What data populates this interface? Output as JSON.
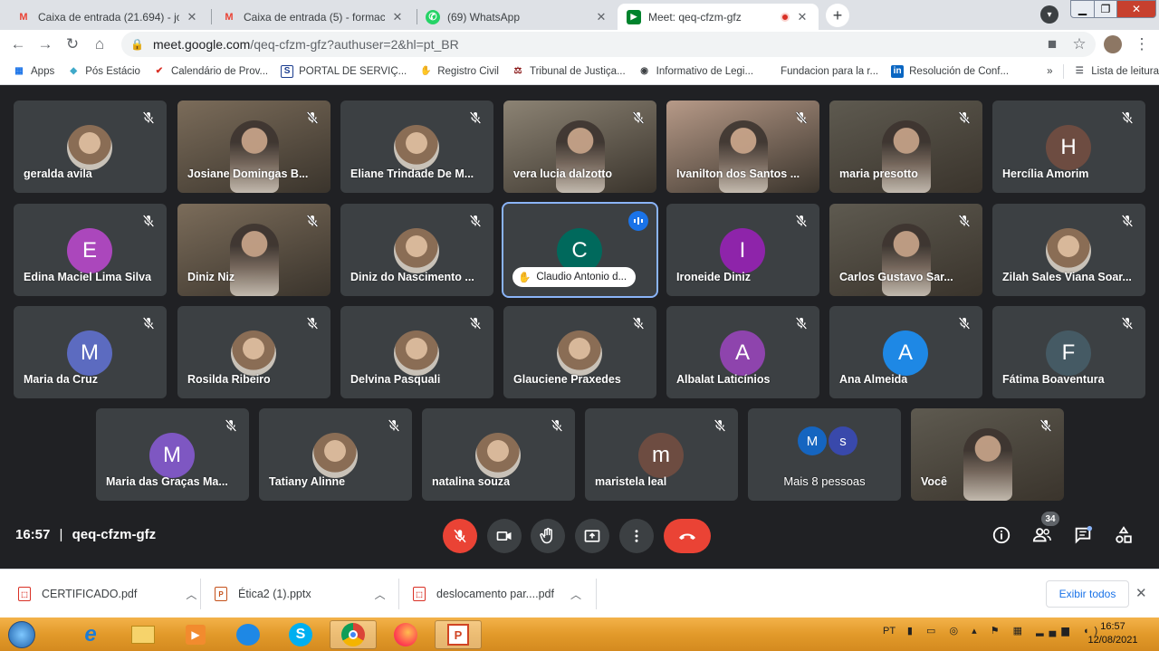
{
  "browser": {
    "tabs": [
      {
        "title": "Caixa de entrada (21.694) - josele",
        "icon": "gmail-icon",
        "active": false
      },
      {
        "title": "Caixa de entrada (5) - formacao@",
        "icon": "gmail-icon",
        "active": false
      },
      {
        "title": "(69) WhatsApp",
        "icon": "whatsapp-icon",
        "active": false
      },
      {
        "title": "Meet: qeq-cfzm-gfz",
        "icon": "meet-icon",
        "active": true
      }
    ],
    "url_host": "meet.google.com",
    "url_path": "/qeq-cfzm-gfz?authuser=2&hl=pt_BR",
    "bookmarks": [
      {
        "label": "Apps",
        "icon": "apps-grid-icon"
      },
      {
        "label": "Pós Estácio",
        "icon": "diamond-icon"
      },
      {
        "label": "Calendário de Prov...",
        "icon": "check-icon"
      },
      {
        "label": "PORTAL DE SERVIÇ...",
        "icon": "s-logo-icon"
      },
      {
        "label": "Registro Civil",
        "icon": "hand-icon"
      },
      {
        "label": "Tribunal de Justiça...",
        "icon": "court-icon"
      },
      {
        "label": "Informativo de Legi...",
        "icon": "globe-icon"
      },
      {
        "label": "Fundacion para la r...",
        "icon": ""
      },
      {
        "label": "Resolución de Conf...",
        "icon": "linkedin-icon"
      }
    ],
    "bookmarks_more": "»",
    "reading_list": "Lista de leitura"
  },
  "meet": {
    "rows": [
      [
        {
          "name": "geralda avila",
          "type": "photo-avatar"
        },
        {
          "name": "Josiane Domingas B...",
          "type": "video"
        },
        {
          "name": "Eliane Trindade De M...",
          "type": "photo-avatar"
        },
        {
          "name": "vera lucia dalzotto",
          "type": "video"
        },
        {
          "name": "Ivanilton dos Santos ...",
          "type": "video"
        },
        {
          "name": "maria presotto",
          "type": "video"
        },
        {
          "name": "Hercília Amorim",
          "type": "letter",
          "letter": "H",
          "color": "#6d4c41"
        }
      ],
      [
        {
          "name": "Edina Maciel Lima Silva",
          "type": "letter",
          "letter": "E",
          "color": "#ab47bc"
        },
        {
          "name": "Diniz Niz",
          "type": "video"
        },
        {
          "name": "Diniz do Nascimento ...",
          "type": "photo-avatar"
        },
        {
          "name": "Claudio Antonio d...",
          "type": "letter",
          "letter": "C",
          "color": "#00695c",
          "speaking": true,
          "hand": true
        },
        {
          "name": "Ironeide Diniz",
          "type": "letter",
          "letter": "I",
          "color": "#8e24aa"
        },
        {
          "name": "Carlos Gustavo Sar...",
          "type": "video"
        },
        {
          "name": "Zilah Sales Viana Soar...",
          "type": "photo-avatar"
        }
      ],
      [
        {
          "name": "Maria da Cruz",
          "type": "letter",
          "letter": "M",
          "color": "#5c6bc0"
        },
        {
          "name": "Rosilda Ribeiro",
          "type": "photo-avatar"
        },
        {
          "name": "Delvina Pasquali",
          "type": "photo-avatar"
        },
        {
          "name": "Glauciene Praxedes",
          "type": "photo-avatar"
        },
        {
          "name": "Albalat Laticínios",
          "type": "letter",
          "letter": "A",
          "color": "#8e44ad"
        },
        {
          "name": "Ana Almeida",
          "type": "letter",
          "letter": "A",
          "color": "#1e88e5"
        },
        {
          "name": "Fátima Boaventura",
          "type": "letter",
          "letter": "F",
          "color": "#455a64"
        }
      ],
      [
        {
          "name": "Maria das Graças Ma...",
          "type": "letter",
          "letter": "M",
          "color": "#7e57c2"
        },
        {
          "name": "Tatiany Alinne",
          "type": "photo-avatar"
        },
        {
          "name": "natalina souza",
          "type": "photo-avatar"
        },
        {
          "name": "maristela leal",
          "type": "letter",
          "letter": "m",
          "color": "#6d4c41"
        },
        {
          "name": "Mais 8 pessoas",
          "type": "more",
          "letters": [
            "M",
            "s"
          ]
        },
        {
          "name": "Você",
          "type": "video"
        }
      ]
    ],
    "time": "16:57",
    "meeting_code": "qeq-cfzm-gfz",
    "participant_count": "34"
  },
  "downloads": {
    "items": [
      {
        "name": "CERTIFICADO.pdf",
        "icon": "pdf-file-icon"
      },
      {
        "name": "Ética2 (1).pptx",
        "icon": "pptx-file-icon"
      },
      {
        "name": "deslocamento par....pdf",
        "icon": "pdf-file-icon"
      }
    ],
    "show_all": "Exibir todos"
  },
  "taskbar": {
    "lang": "PT",
    "time": "16:57",
    "date": "12/08/2021"
  }
}
